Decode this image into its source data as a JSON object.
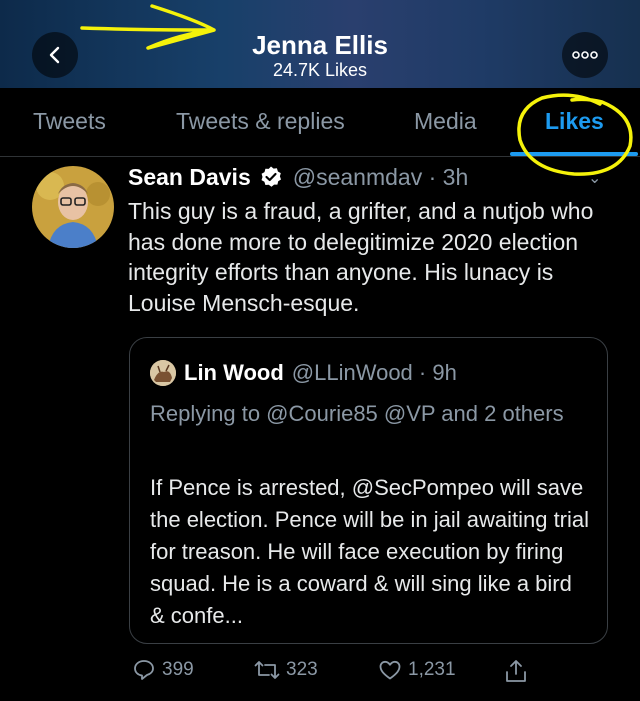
{
  "profile": {
    "name": "Jenna Ellis",
    "likes_count": "24.7K Likes"
  },
  "tabs": [
    {
      "label": "Tweets",
      "active": false
    },
    {
      "label": "Tweets & replies",
      "active": false
    },
    {
      "label": "Media",
      "active": false
    },
    {
      "label": "Likes",
      "active": true
    }
  ],
  "tweet": {
    "author_name": "Sean Davis",
    "verified": true,
    "handle_time": "@seanmdav · 3h",
    "text": "This guy is a fraud, a grifter, and a nutjob who has done more to delegitimize 2020 election integrity efforts than anyone. His lunacy is Louise Mensch-esque.",
    "quote": {
      "author_name": "Lin Wood",
      "handle_time": "@LLinWood · 9h",
      "replying_to": "Replying to @Courie85 @VP and 2 others",
      "text": "If Pence is arrested, @SecPompeo will save the election. Pence will be in jail awaiting trial for treason. He will face execution by firing squad. He is a coward & will sing like a bird & confe..."
    },
    "replies": "399",
    "retweets": "323",
    "likes": "1,231"
  },
  "icons": {
    "back": "chevron-left-icon",
    "more": "more-icon",
    "verified": "verified-badge-icon",
    "reply": "reply-icon",
    "retweet": "retweet-icon",
    "like": "heart-icon",
    "share": "share-icon"
  },
  "colors": {
    "accent": "#1d9bf0",
    "annotation": "#f5f20a",
    "background": "#000000",
    "muted_text": "#8b98a5"
  }
}
